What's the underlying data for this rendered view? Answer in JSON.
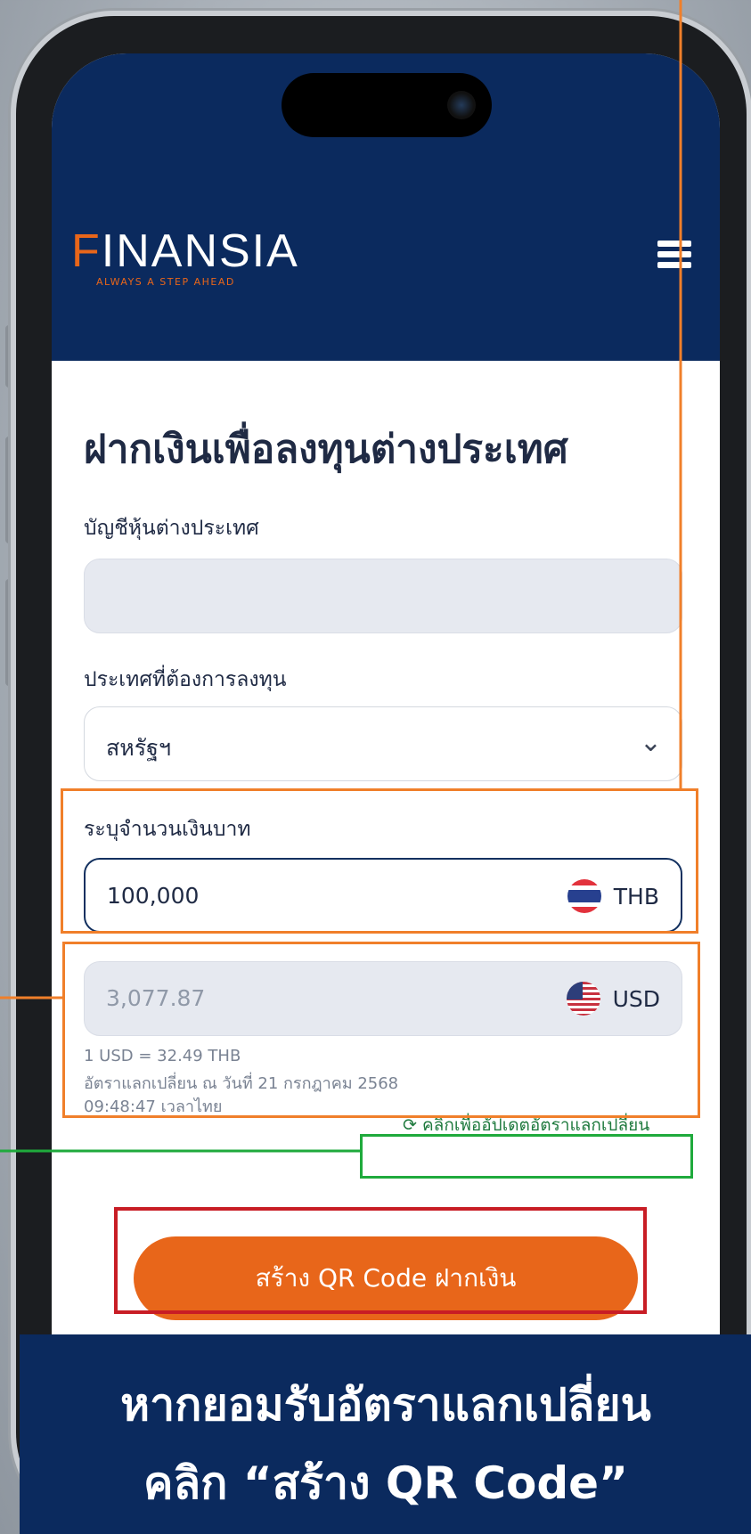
{
  "app": {
    "logo_text_initial": "F",
    "logo_text_rest": "INANSIA",
    "tagline": "ALWAYS A STEP AHEAD"
  },
  "page": {
    "title": "ฝากเงินเพื่อลงทุนต่างประเทศ"
  },
  "form": {
    "account_label": "บัญชีหุ้นต่างประเทศ",
    "account_value": "",
    "country_label": "ประเทศที่ต้องการลงทุน",
    "country_value": "สหรัฐฯ",
    "amount_label": "ระบุจำนวนเงินบาท",
    "amount_value": "100,000",
    "amount_currency": "THB",
    "converted_value": "3,077.87",
    "converted_currency": "USD",
    "rate_line": "1 USD = 32.49 THB",
    "rate_date_line": "อัตราแลกเปลี่ยน ณ วันที่ 21 กรกฎาคม 2568",
    "rate_time_line": "09:48:47 เวลาไทย",
    "refresh_label": "คลิกเพื่ออัปเดตอัตราแลกเปลี่ยน",
    "submit_label": "สร้าง QR Code ฝากเงิน"
  },
  "banner": {
    "line1": "หากยอมรับอัตราแลกเปลี่ยน",
    "line2": "คลิก “สร้าง QR Code”"
  },
  "icons": {
    "menu": "hamburger-icon",
    "dropdown": "chevron-down-icon",
    "refresh": "refresh-icon",
    "flag_th": "thailand-flag-icon",
    "flag_us": "usa-flag-icon"
  },
  "colors": {
    "brand_navy": "#0b2a5e",
    "brand_orange": "#e8661a",
    "highlight_orange": "#f07f2a",
    "highlight_green": "#1faa3c",
    "highlight_red": "#c81d25"
  }
}
